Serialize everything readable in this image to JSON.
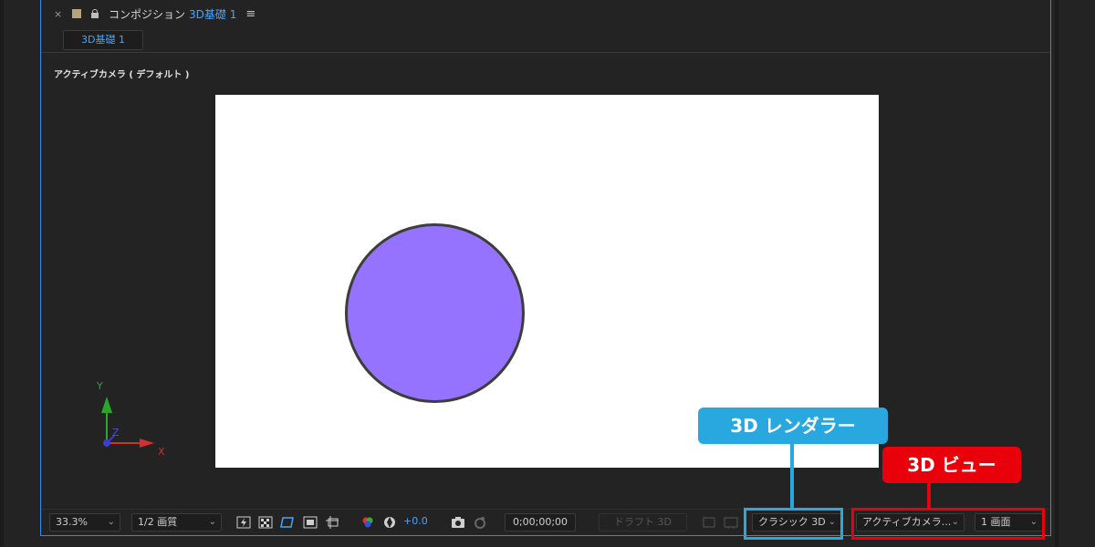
{
  "panel": {
    "close": "×",
    "comp_label": "コンポジション",
    "comp_name": "3D基礎 1",
    "menu": "≡",
    "tab_label": "3D基礎 1"
  },
  "viewer": {
    "camera_label": "アクティブカメラ ( デフォルト )",
    "canvas_color": "#ffffff",
    "circle_color": "#9673ff",
    "axes": {
      "x": "X",
      "y": "Y",
      "z": "Z"
    }
  },
  "toolbar": {
    "zoom": "33.3%",
    "resolution": "1/2 画質",
    "exposure": "+0.0",
    "timecode": "0;00;00;00",
    "draft3d": "ドラフト 3D",
    "renderer": "クラシック 3D",
    "view": "アクティブカメラ...",
    "layout": "1 画面"
  },
  "callouts": {
    "renderer": "3D レンダラー",
    "view": "3D ビュー",
    "renderer_color": "#29a8e0",
    "view_color": "#e8000b"
  }
}
